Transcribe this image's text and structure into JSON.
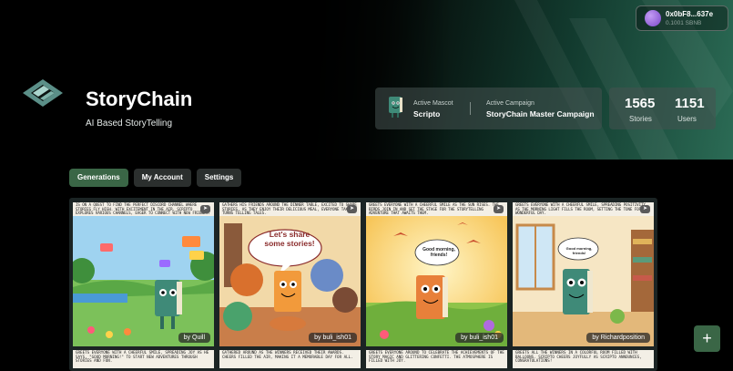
{
  "wallet": {
    "address": "0x0bF8...637e",
    "balance": "0.1001 SBNB"
  },
  "brand": {
    "title": "StoryChain",
    "subtitle": "AI Based StoryTelling",
    "accent": "#3a6646"
  },
  "mascot": {
    "label": "Active Mascot",
    "name": "Scripto",
    "icon": "book-mascot-icon"
  },
  "campaign": {
    "label": "Active Campaign",
    "name": "StoryChain Master Campaign"
  },
  "stats": {
    "stories_value": "1565",
    "stories_label": "Stories",
    "users_value": "1151",
    "users_label": "Users"
  },
  "tabs": [
    {
      "label": "Generations",
      "active": true
    },
    {
      "label": "My Account",
      "active": false
    },
    {
      "label": "Settings",
      "active": false
    }
  ],
  "stories": [
    {
      "text": "IS ON A QUEST TO FIND THE PERFECT DISCORD CHANNEL WHERE STORIES FLY HIGH. WITH EXCITEMENT IN THE AIR, SCRIPTO EXPLORES VARIOUS CHANNELS, EAGER TO CONNECT WITH NEW FRIENDS.",
      "author": "by Quill"
    },
    {
      "text": "GATHERS HIS FRIENDS AROUND THE DINNER TABLE, EXCITED TO SHARE STORIES. AS THEY ENJOY THEIR DELICIOUS MEAL, EVERYONE TAKES TURNS TELLING TALES.",
      "author": "by buli_ish01",
      "bubble": "Let's share some stories!"
    },
    {
      "text": "GREETS EVERYONE WITH A CHEERFUL SMILE AS THE SUN RISES. THE BIRDS JOIN IN AND SET THE STAGE FOR THE STORYTELLING ADVENTURE THAT AWAITS THEM.",
      "author": "by buli_ish01",
      "bubble": "Good morning, friends!"
    },
    {
      "text": "GREETS EVERYONE WITH A CHEERFUL SMILE, SPREADING POSITIVITY AS THE MORNING LIGHT FILLS THE ROOM, SETTING THE TONE FOR A WONDERFUL DAY.",
      "author": "by Richardposition",
      "bubble": "Good morning, friends!"
    }
  ],
  "stories_row2": [
    "GREETS EVERYONE WITH A CHEERFUL SMILE, SPREADING JOY AS HE SAYS, \"GOOD MORNING!\" TO START NEW ADVENTURES THROUGH STORIES AND FUN.",
    "GATHERED AROUND AS THE WINNERS RECEIVED THEIR AWARDS. CHEERS FILLED THE AIR, MAKING IT A MEMORABLE DAY FOR ALL.",
    "GREETS EVERYONE AROUND TO CELEBRATE THE ACHIEVEMENTS OF THE STORY MAGIC AND GLITTERING CONFETTI. THE ATMOSPHERE IS FILLED WITH JOY.",
    "GREETS ALL THE WINNERS IN A COLORFUL ROOM FILLED WITH BALLOONS. SCRIPTO CHEERS JOYFULLY AS SCRIPTO ANNOUNCES, CONGRATULATIONS!"
  ],
  "fab": {
    "label": "+"
  }
}
